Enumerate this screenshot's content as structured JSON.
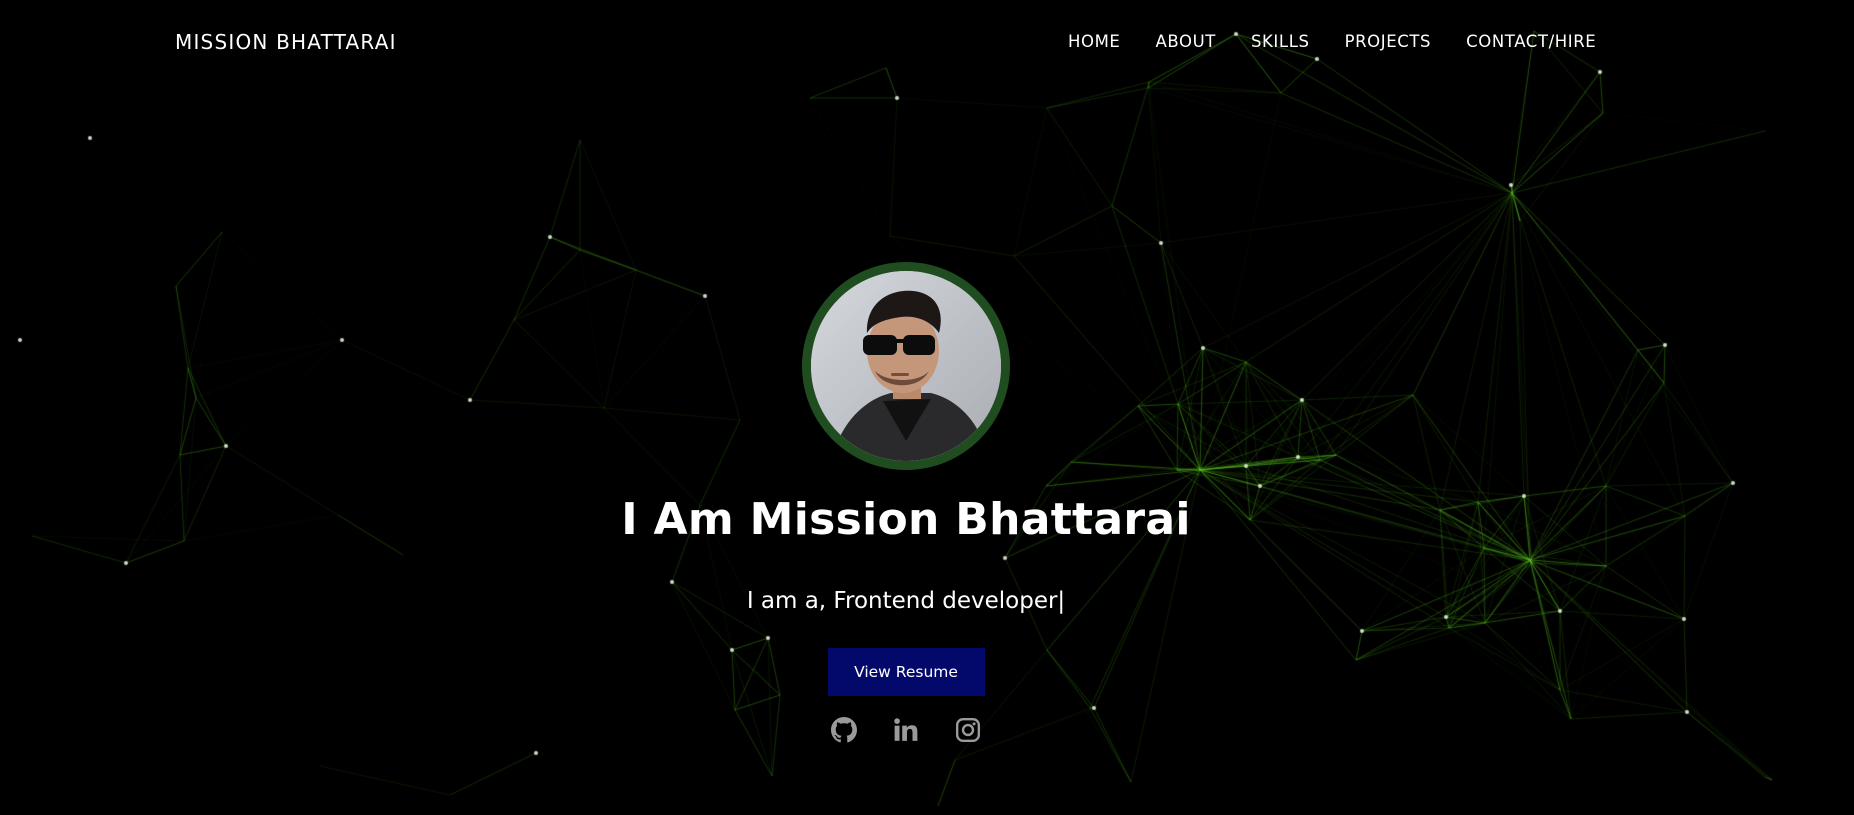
{
  "header": {
    "brand": "MISSION BHATTARAI",
    "nav": [
      {
        "label": "HOME"
      },
      {
        "label": "ABOUT"
      },
      {
        "label": "SKILLS"
      },
      {
        "label": "PROJECTS"
      },
      {
        "label": "CONTACT/HIRE"
      }
    ]
  },
  "hero": {
    "title": "I Am Mission Bhattarai",
    "subtitle": "I am a, Frontend developer|",
    "resume_button": "View Resume",
    "socials": [
      {
        "icon": "github-icon"
      },
      {
        "icon": "linkedin-icon"
      },
      {
        "icon": "instagram-icon"
      }
    ]
  },
  "colors": {
    "background": "#000000",
    "network_line": "#4caf1a",
    "avatar_ring": "#1f4d1f",
    "button": "#03096b",
    "social_icon": "#9a9a9a"
  }
}
